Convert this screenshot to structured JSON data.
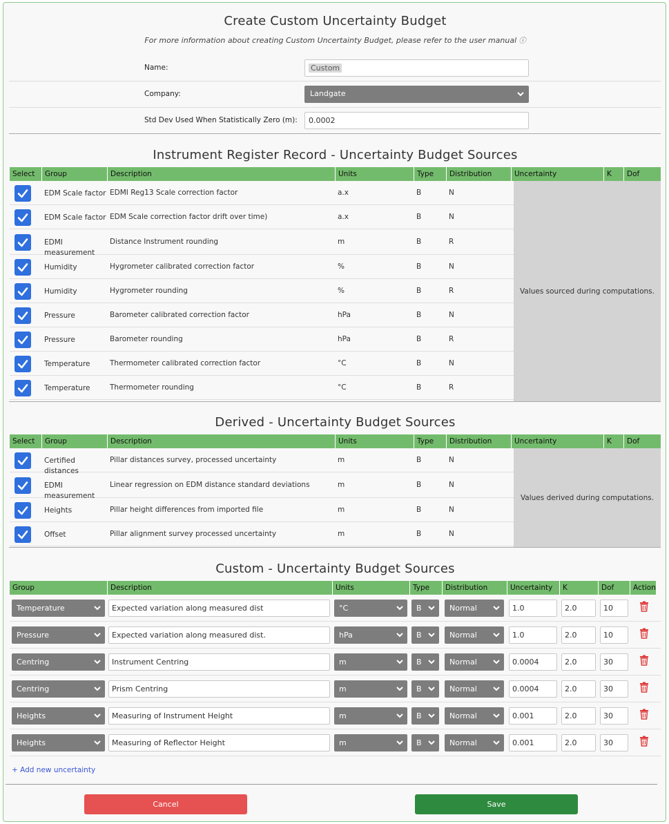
{
  "header": {
    "title": "Create Custom Uncertainty Budget",
    "subtitle": "For more information about creating Custom Uncertainty Budget, please refer to the user manual",
    "info_icon": "ⓘ"
  },
  "form": {
    "name_label": "Name:",
    "name_value": "Custom",
    "company_label": "Company:",
    "company_value": "Landgate",
    "stddev_label": "Std Dev Used When Statistically Zero (m):",
    "stddev_value": "0.0002"
  },
  "instrument_section": {
    "title": "Instrument Register Record - Uncertainty Budget Sources",
    "columns": [
      "Select",
      "Group",
      "Description",
      "Units",
      "Type",
      "Distribution",
      "Uncertainty",
      "K",
      "Dof"
    ],
    "rows": [
      {
        "group": "EDM Scale factor",
        "description": "EDMI Reg13 Scale correction factor",
        "units": "a.x",
        "type": "B",
        "distribution": "N"
      },
      {
        "group": "EDM Scale factor",
        "description": "EDM Scale correction factor drift over time)",
        "units": "a.x",
        "type": "B",
        "distribution": "N"
      },
      {
        "group": "EDMI measurement",
        "description": "Distance Instrument rounding",
        "units": "m",
        "type": "B",
        "distribution": "R"
      },
      {
        "group": "Humidity",
        "description": "Hygrometer calibrated correction factor",
        "units": "%",
        "type": "B",
        "distribution": "N"
      },
      {
        "group": "Humidity",
        "description": "Hygrometer rounding",
        "units": "%",
        "type": "B",
        "distribution": "R"
      },
      {
        "group": "Pressure",
        "description": "Barometer calibrated correction factor",
        "units": "hPa",
        "type": "B",
        "distribution": "N"
      },
      {
        "group": "Pressure",
        "description": "Barometer rounding",
        "units": "hPa",
        "type": "B",
        "distribution": "R"
      },
      {
        "group": "Temperature",
        "description": "Thermometer calibrated correction factor",
        "units": "°C",
        "type": "B",
        "distribution": "N"
      },
      {
        "group": "Temperature",
        "description": "Thermometer rounding",
        "units": "°C",
        "type": "B",
        "distribution": "R"
      }
    ],
    "values_note": "Values sourced during computations."
  },
  "derived_section": {
    "title": "Derived - Uncertainty Budget Sources",
    "columns": [
      "Select",
      "Group",
      "Description",
      "Units",
      "Type",
      "Distribution",
      "Uncertainty",
      "K",
      "Dof"
    ],
    "rows": [
      {
        "group": "Certified distances",
        "description": "Pillar distances survey, processed uncertainty",
        "units": "m",
        "type": "B",
        "distribution": "N"
      },
      {
        "group": "EDMI measurement",
        "description": "Linear regression on EDM distance standard deviations",
        "units": "m",
        "type": "B",
        "distribution": "N"
      },
      {
        "group": "Heights",
        "description": "Pillar height differences from imported file",
        "units": "m",
        "type": "B",
        "distribution": "N"
      },
      {
        "group": "Offset",
        "description": "Pillar alignment survey processed uncertainty",
        "units": "m",
        "type": "B",
        "distribution": "N"
      }
    ],
    "values_note": "Values derived during computations."
  },
  "custom_section": {
    "title": "Custom - Uncertainty Budget Sources",
    "columns": [
      "Group",
      "Description",
      "Units",
      "Type",
      "Distribution",
      "Uncertainty",
      "K",
      "Dof",
      "Action"
    ],
    "rows": [
      {
        "group": "Temperature",
        "description": "Expected variation along measured dist",
        "units": "°C",
        "type": "B",
        "distribution": "Normal",
        "uncertainty": "1.0",
        "k": "2.0",
        "dof": "10"
      },
      {
        "group": "Pressure",
        "description": "Expected variation along measured dist.",
        "units": "hPa",
        "type": "B",
        "distribution": "Normal",
        "uncertainty": "1.0",
        "k": "2.0",
        "dof": "10"
      },
      {
        "group": "Centring",
        "description": "Instrument Centring",
        "units": "m",
        "type": "B",
        "distribution": "Normal",
        "uncertainty": "0.0004",
        "k": "2.0",
        "dof": "30"
      },
      {
        "group": "Centring",
        "description": "Prism Centring",
        "units": "m",
        "type": "B",
        "distribution": "Normal",
        "uncertainty": "0.0004",
        "k": "2.0",
        "dof": "30"
      },
      {
        "group": "Heights",
        "description": "Measuring of Instrument Height",
        "units": "m",
        "type": "B",
        "distribution": "Normal",
        "uncertainty": "0.001",
        "k": "2.0",
        "dof": "30"
      },
      {
        "group": "Heights",
        "description": "Measuring of Reflector Height",
        "units": "m",
        "type": "B",
        "distribution": "Normal",
        "uncertainty": "0.001",
        "k": "2.0",
        "dof": "30"
      }
    ],
    "add_link": "+ Add new uncertainty"
  },
  "buttons": {
    "cancel": "Cancel",
    "save": "Save"
  },
  "colors": {
    "header_green": "#73bb6c",
    "checkbox_blue": "#2f6fde",
    "cancel_red": "#e65151",
    "save_green": "#2d8a3e",
    "trash_red": "#e03c3c"
  }
}
